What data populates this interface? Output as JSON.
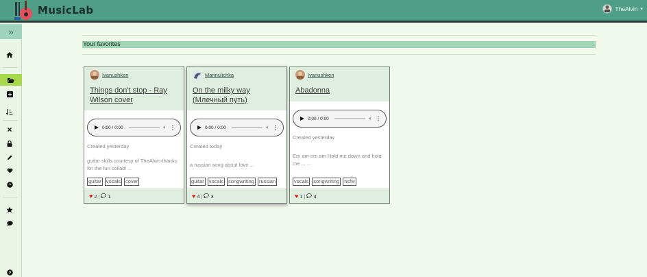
{
  "header": {
    "brand": "MusicLab",
    "user_name": "TheAlvin",
    "caret": "▾"
  },
  "sidebar": {
    "toggle": "»",
    "icons": [
      "home-icon",
      "folder-open-icon",
      "plus-icon",
      "sort-icon",
      "close-icon",
      "lock-icon",
      "pencil-icon",
      "heart-icon",
      "clock-icon",
      "star-icon",
      "comment-icon",
      "help-icon"
    ],
    "active_item": "folder-open-icon"
  },
  "favorites": {
    "title": "Your favorites"
  },
  "player_time": "0:00 / 0:00",
  "cards": [
    {
      "author": "Ivanushken",
      "title": "Things don't stop - Ray Wilson cover",
      "created": "Created yesterday",
      "description": "guitar skills courtesy of TheAlvin-thanks for the fun collab! ...",
      "tags": [
        "guitar",
        "vocals",
        "cover"
      ],
      "likes": "2",
      "comments": "1"
    },
    {
      "author": "Marinulichka",
      "title": "On the milky way (Млечный путь)",
      "created": "Created today",
      "description": "a russian song about love ...",
      "tags": [
        "guitar",
        "vocals",
        "songwriting",
        "russian"
      ],
      "likes": "4",
      "comments": "3"
    },
    {
      "author": "Ivanushken",
      "title": "Abadonna",
      "created": "Created yesterday",
      "description": "Em am em am Hold me down and hold me ... ...",
      "tags": [
        "vocals",
        "songwriting",
        "nsfw"
      ],
      "likes": "1",
      "comments": "4"
    }
  ],
  "colors": {
    "header_bg": "#4e9f86",
    "page_bg": "#f1f8ec",
    "favorites_bar": "#9fd6b5",
    "active_sidebar": "#a6d84b",
    "heart": "#e01818"
  }
}
